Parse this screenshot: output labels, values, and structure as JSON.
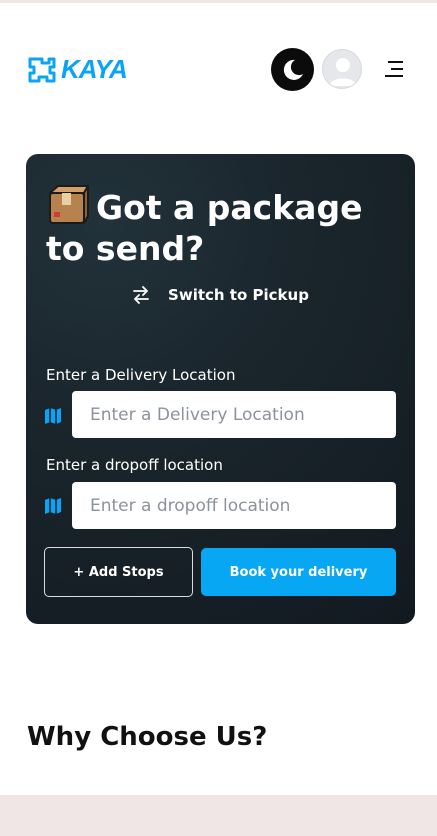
{
  "header": {
    "logo_text": "KAYA",
    "brand_color": "#0aa3f5",
    "theme_toggle_icon": "moon-icon",
    "avatar_icon": "user-avatar-icon",
    "menu_icon": "hamburger-menu-icon"
  },
  "hero": {
    "package_icon": "package-box-icon",
    "title": "Got a package to send?",
    "switch_icon": "swap-arrows-icon",
    "switch_label": "Switch to Pickup",
    "delivery": {
      "label": "Enter a Delivery Location",
      "placeholder": "Enter a Delivery Location",
      "value": "",
      "icon": "map-icon"
    },
    "dropoff": {
      "label": "Enter a dropoff location",
      "placeholder": "Enter a dropoff location",
      "value": "",
      "icon": "map-icon"
    },
    "add_stops_label": "+ Add Stops",
    "book_label": "Book your delivery",
    "accent_color": "#07a7f3"
  },
  "why_section": {
    "title": "Why Choose Us?"
  }
}
